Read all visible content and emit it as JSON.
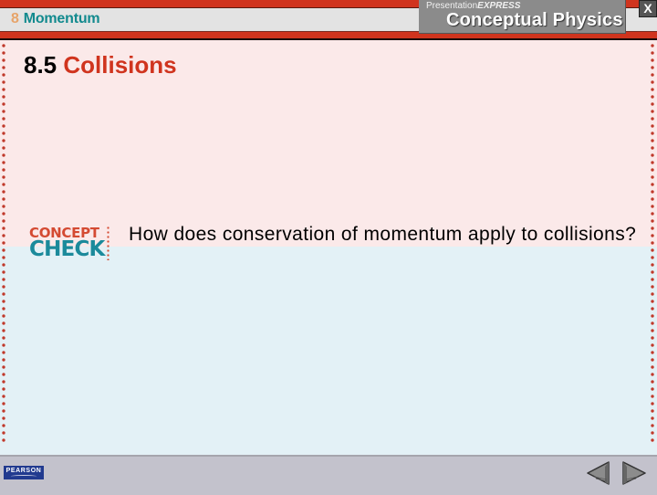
{
  "header": {
    "chapter_number": "8",
    "chapter_title": "Momentum",
    "brand_small_regular": "Presentation",
    "brand_small_bold": "EXPRESS",
    "brand_title": "Conceptual Physics",
    "close_label": "X"
  },
  "slide": {
    "section_number": "8.5",
    "section_title": "Collisions",
    "badge_top": "CONCEPT",
    "badge_bottom": "CHECK",
    "question": "How does conservation of momentum apply to collisions?"
  },
  "footer": {
    "publisher": "PEARSON",
    "prev_icon": "previous-slide-triangle",
    "next_icon": "next-slide-triangle"
  },
  "colors": {
    "accent_red": "#d0341e",
    "teal": "#128a8e",
    "pink_bg": "#fbe9e9",
    "blue_bg": "#e3f1f6",
    "footer_gray": "#c3c2cc"
  }
}
